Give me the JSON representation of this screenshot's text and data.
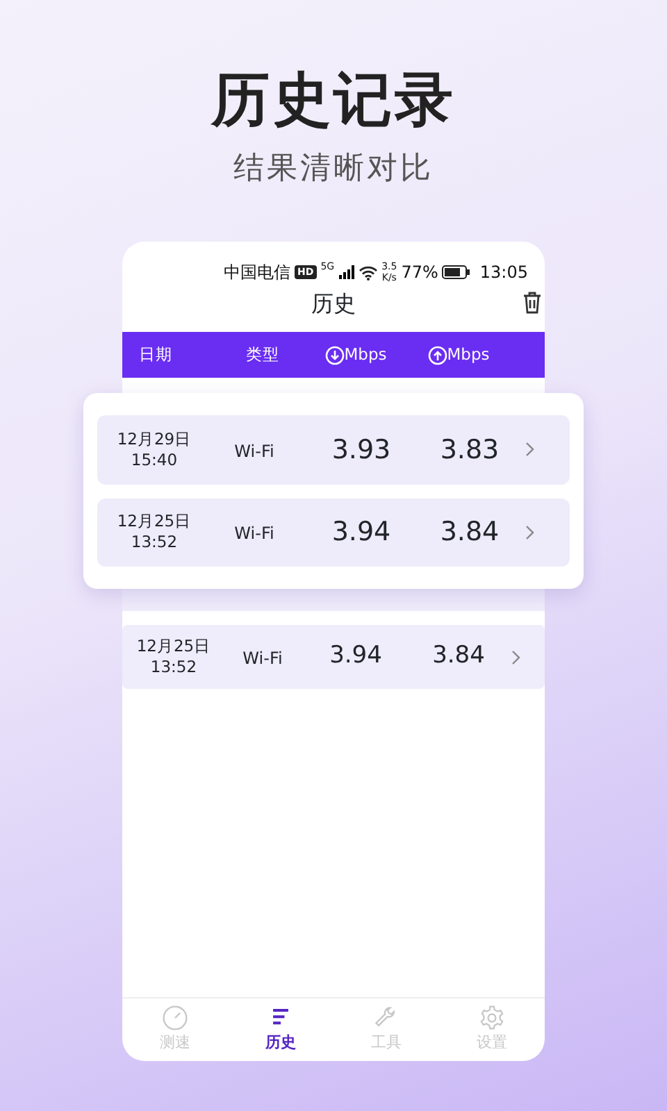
{
  "headline": "历史记录",
  "subtitle": "结果清晰对比",
  "status_bar": {
    "carrier": "中国电信",
    "hd": "HD",
    "network": "5G",
    "speed": "3.5",
    "speed_unit": "K/s",
    "battery": "77%",
    "time": "13:05"
  },
  "title": "历史",
  "columns": [
    {
      "label": "日期",
      "kind": "text"
    },
    {
      "label": "类型",
      "kind": "text"
    },
    {
      "label": "Mbps",
      "kind": "download"
    },
    {
      "label": "Mbps",
      "kind": "upload"
    }
  ],
  "popup_rows": [
    {
      "date": "12月29日",
      "time": "15:40",
      "type": "Wi-Fi",
      "download": "3.93",
      "upload": "3.83"
    },
    {
      "date": "12月25日",
      "time": "13:52",
      "type": "Wi-Fi",
      "download": "3.94",
      "upload": "3.84"
    }
  ],
  "rows": [
    {
      "date": "12月25日",
      "time": "13:52",
      "type": "Wi-Fi",
      "download": "3.94",
      "upload": "3.84"
    }
  ],
  "nav": [
    {
      "label": "测速",
      "kind": "speed",
      "selected": false
    },
    {
      "label": "历史",
      "kind": "history",
      "selected": true
    },
    {
      "label": "工具",
      "kind": "tools",
      "selected": false
    },
    {
      "label": "设置",
      "kind": "settings",
      "selected": false
    }
  ]
}
